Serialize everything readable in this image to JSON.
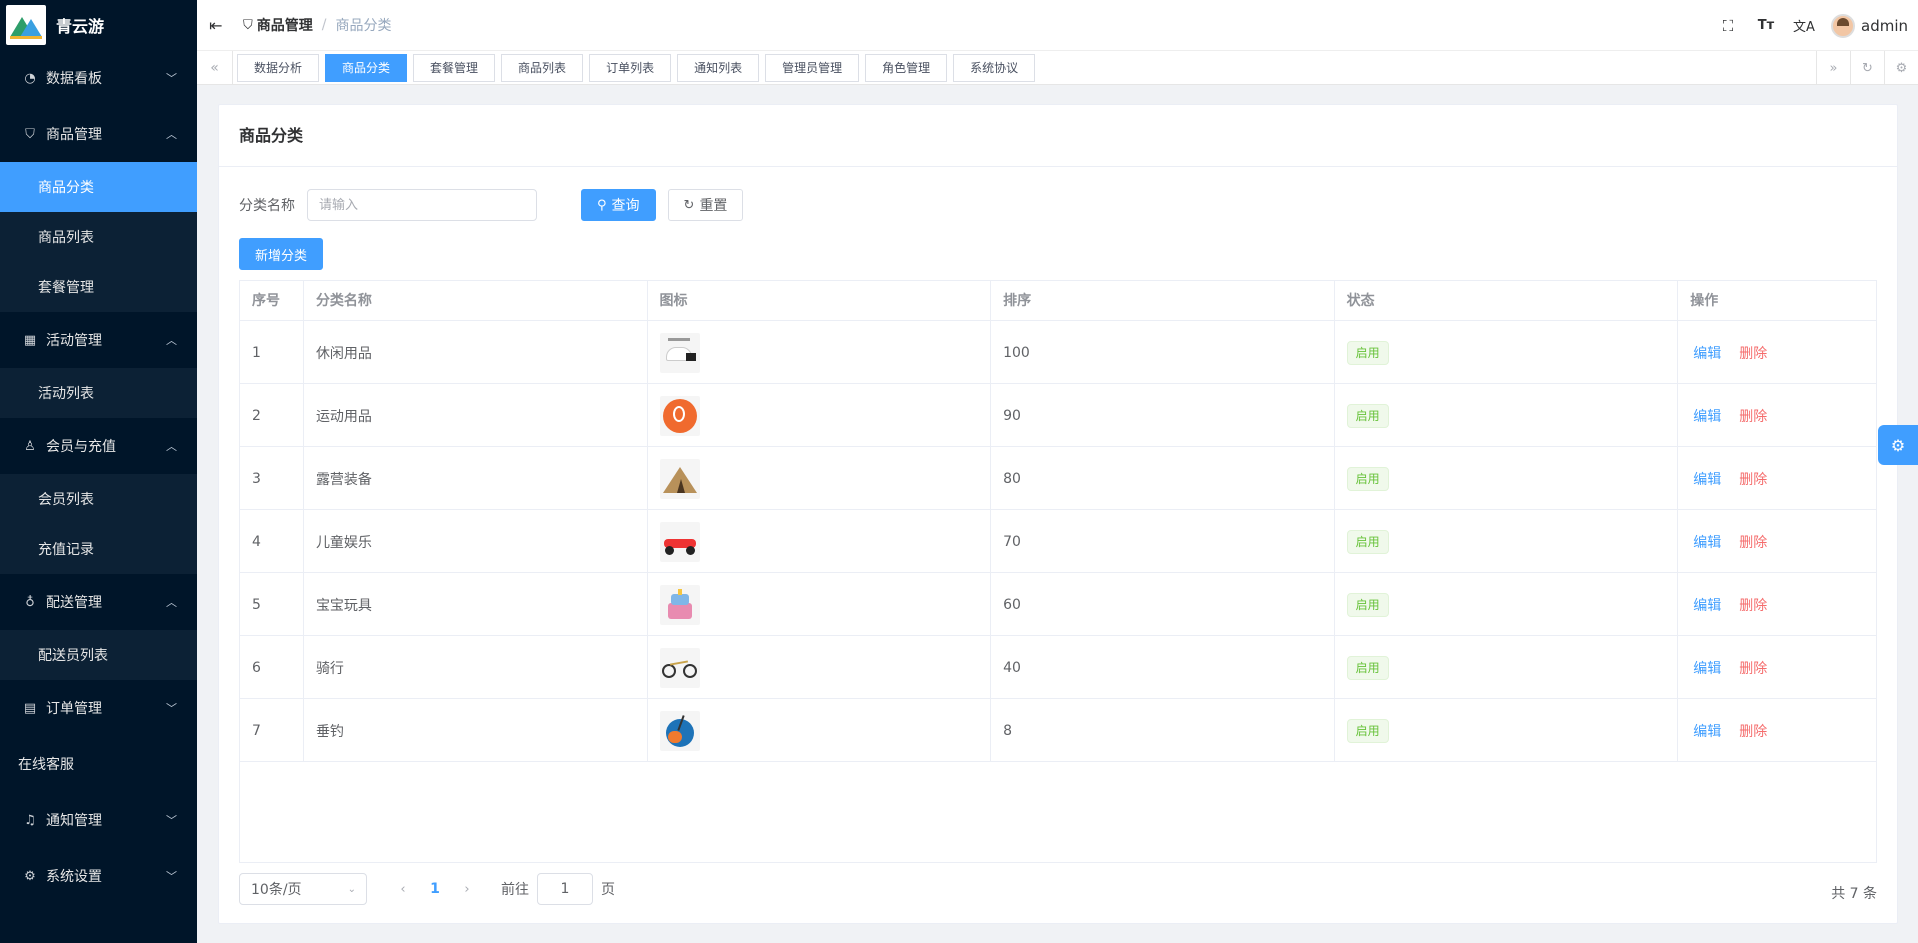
{
  "app": {
    "name": "青云游"
  },
  "sidebar": {
    "groups": [
      {
        "label": "数据看板",
        "icon": "dashboard-icon",
        "chevron": "⌄",
        "children": []
      },
      {
        "label": "商品管理",
        "icon": "shopping-bag-icon",
        "chevron": "⌃",
        "children": [
          {
            "label": "商品分类",
            "active": true
          },
          {
            "label": "商品列表"
          },
          {
            "label": "套餐管理"
          }
        ]
      },
      {
        "label": "活动管理",
        "icon": "calendar-icon",
        "chevron": "⌃",
        "children": [
          {
            "label": "活动列表"
          }
        ]
      },
      {
        "label": "会员与充值",
        "icon": "user-icon",
        "chevron": "⌃",
        "children": [
          {
            "label": "会员列表"
          },
          {
            "label": "充值记录"
          }
        ]
      },
      {
        "label": "配送管理",
        "icon": "bicycle-icon",
        "chevron": "⌃",
        "children": [
          {
            "label": "配送员列表"
          }
        ]
      },
      {
        "label": "订单管理",
        "icon": "document-icon",
        "chevron": "⌄",
        "children": []
      }
    ],
    "plain_item": "在线客服",
    "bottom_groups": [
      {
        "label": "通知管理",
        "icon": "bell-icon",
        "chevron": "⌄"
      },
      {
        "label": "系统设置",
        "icon": "gear-icon",
        "chevron": "⌄"
      }
    ]
  },
  "header": {
    "breadcrumb": [
      "商品管理",
      "商品分类"
    ],
    "icons": [
      "fullscreen-icon",
      "font-size-icon",
      "translate-icon"
    ],
    "username": "admin"
  },
  "tags": [
    {
      "label": "数据分析"
    },
    {
      "label": "商品分类",
      "active": true
    },
    {
      "label": "套餐管理"
    },
    {
      "label": "商品列表"
    },
    {
      "label": "订单列表"
    },
    {
      "label": "通知列表"
    },
    {
      "label": "管理员管理"
    },
    {
      "label": "角色管理"
    },
    {
      "label": "系统协议"
    }
  ],
  "card": {
    "title": "商品分类",
    "filter": {
      "label": "分类名称",
      "placeholder": "请输入",
      "value": ""
    },
    "search_label": "查询",
    "reset_label": "重置",
    "add_label": "新增分类"
  },
  "table": {
    "columns": [
      "序号",
      "分类名称",
      "图标",
      "排序",
      "状态",
      "操作"
    ],
    "rows": [
      {
        "index": "1",
        "name": "休闲用品",
        "icon": "leisure-cap-icon",
        "sort": "100",
        "status": "启用"
      },
      {
        "index": "2",
        "name": "运动用品",
        "icon": "sports-racket-icon",
        "sort": "90",
        "status": "启用"
      },
      {
        "index": "3",
        "name": "露营装备",
        "icon": "tent-icon",
        "sort": "80",
        "status": "启用"
      },
      {
        "index": "4",
        "name": "儿童娱乐",
        "icon": "go-kart-icon",
        "sort": "70",
        "status": "启用"
      },
      {
        "index": "5",
        "name": "宝宝玩具",
        "icon": "toy-cake-icon",
        "sort": "60",
        "status": "启用"
      },
      {
        "index": "6",
        "name": "骑行",
        "icon": "bicycle-icon",
        "sort": "40",
        "status": "启用"
      },
      {
        "index": "7",
        "name": "垂钓",
        "icon": "fishing-icon",
        "sort": "8",
        "status": "启用"
      }
    ],
    "edit_label": "编辑",
    "delete_label": "删除"
  },
  "pagination": {
    "page_size": "10条/页",
    "current_page": "1",
    "goto_prefix": "前往",
    "goto_value": "1",
    "goto_suffix": "页",
    "total": "共 7 条"
  },
  "colors": {
    "primary": "#409eff",
    "sidebar_bg": "#001529",
    "danger": "#f56c6c",
    "success": "#67c23a"
  }
}
